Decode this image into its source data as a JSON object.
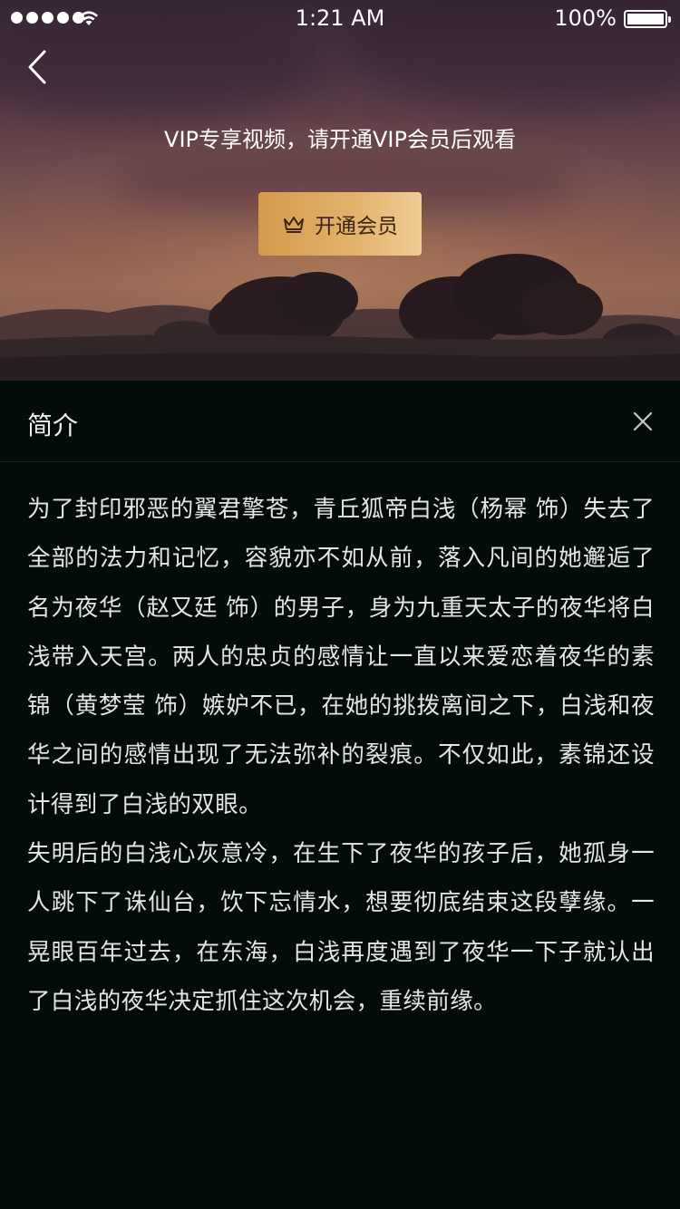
{
  "status_bar": {
    "time": "1:21 AM",
    "battery": "100%"
  },
  "icons": {
    "back": "chevron-left-icon",
    "crown": "crown-icon",
    "close": "close-icon",
    "wifi": "wifi-icon",
    "signal": "signal-icon",
    "battery": "battery-icon"
  },
  "hero": {
    "vip_notice": "VIP专享视频，请开通VIP会员后观看",
    "vip_button_label": "开通会员"
  },
  "intro": {
    "title": "简介",
    "paragraph_1": "为了封印邪恶的翼君擎苍，青丘狐帝白浅（杨幂 饰）失去了全部的法力和记忆，容貌亦不如从前，落入凡间的她邂逅了名为夜华（赵又廷 饰）的男子，身为九重天太子的夜华将白浅带入天宫。两人的忠贞的感情让一直以来爱恋着夜华的素锦（黄梦莹 饰）嫉妒不已，在她的挑拨离间之下，白浅和夜华之间的感情出现了无法弥补的裂痕。不仅如此，素锦还设计得到了白浅的双眼。",
    "paragraph_2": "失明后的白浅心灰意冷，在生下了夜华的孩子后，她孤身一人跳下了诛仙台，饮下忘情水，想要彻底结束这段孽缘。一晃眼百年过去，在东海，白浅再度遇到了夜华一下子就认出了白浅的夜华决定抓住这次机会，重续前缘。"
  },
  "colors": {
    "panel_bg": "#040b0b",
    "vip_gold_start": "#d49a4c",
    "vip_gold_end": "#efcd95",
    "text": "#e6e6e6"
  }
}
